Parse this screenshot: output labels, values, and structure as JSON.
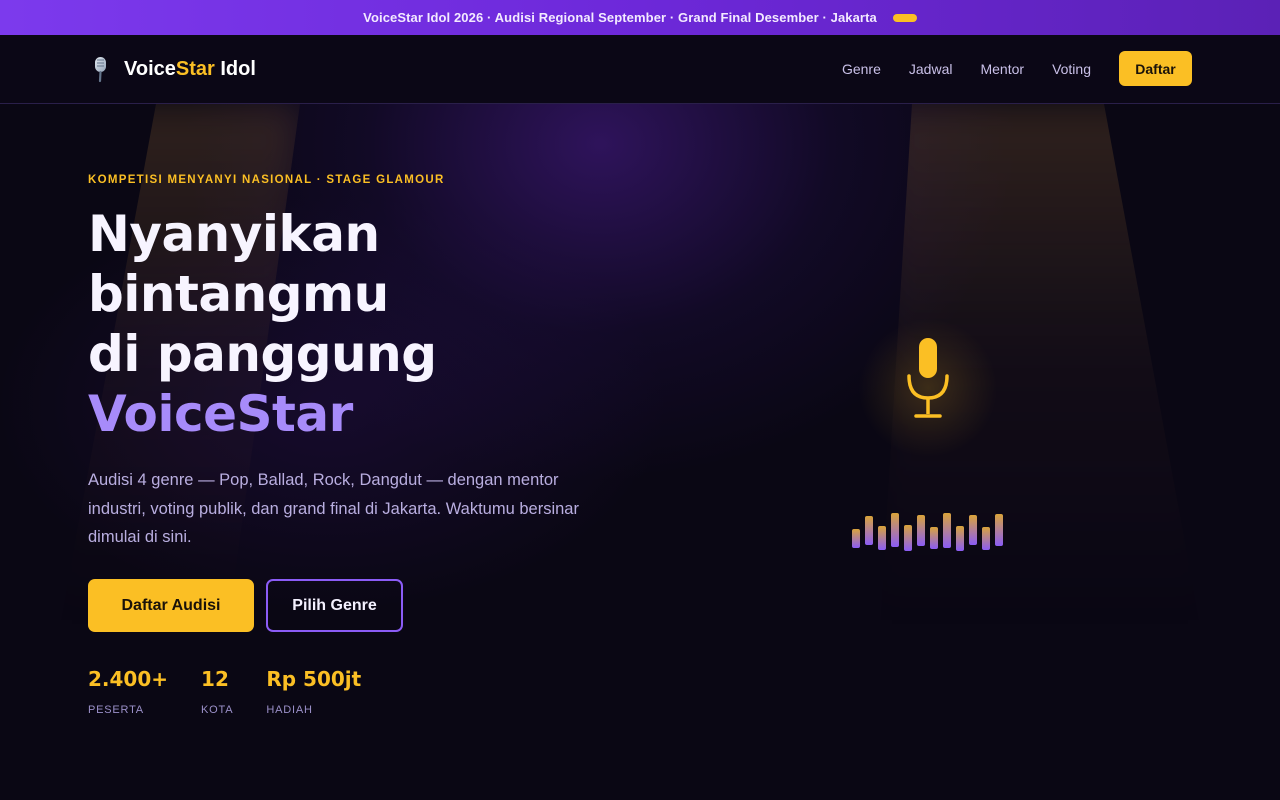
{
  "announcement": {
    "text": "VoiceStar Idol 2026 · Audisi Regional September · Grand Final Desember · Jakarta"
  },
  "brand": {
    "name_part1": "Voice",
    "name_part2": "Star",
    "name_part3": " Idol",
    "logo_icon": "microphone-icon"
  },
  "nav": {
    "links": [
      "Genre",
      "Jadwal",
      "Mentor",
      "Voting"
    ],
    "cta_label": "Daftar"
  },
  "hero": {
    "eyebrow": "KOMPETISI MENYANYI NASIONAL · STAGE GLAMOUR",
    "headline": [
      "Nyanyikan",
      "bintangmu",
      "di panggung",
      "VoiceStar"
    ],
    "lead": "Audisi 4 genre — Pop, Ballad, Rock, Dangdut — dengan mentor industri, voting publik, dan grand final di Jakarta. Waktumu bersinar dimulai di sini.",
    "primary_button": "Daftar Audisi",
    "secondary_button": "Pilih Genre"
  },
  "stats": [
    {
      "value": "2.400+",
      "label": "PESERTA"
    },
    {
      "value": "12",
      "label": "KOTA"
    },
    {
      "value": "Rp 500jt",
      "label": "HADIAH"
    }
  ],
  "stage": {
    "icon": "microphone-icon",
    "equalizer_levels": [
      0.3,
      0.7,
      0.5,
      0.9,
      0.6,
      0.8,
      0.4,
      0.95,
      0.55,
      0.75,
      0.45,
      0.85
    ]
  },
  "colors": {
    "accent_gold": "#fbbf24",
    "accent_violet": "#a78bfa",
    "announce_bg": "#6d28d9",
    "background": "#0a0714"
  }
}
